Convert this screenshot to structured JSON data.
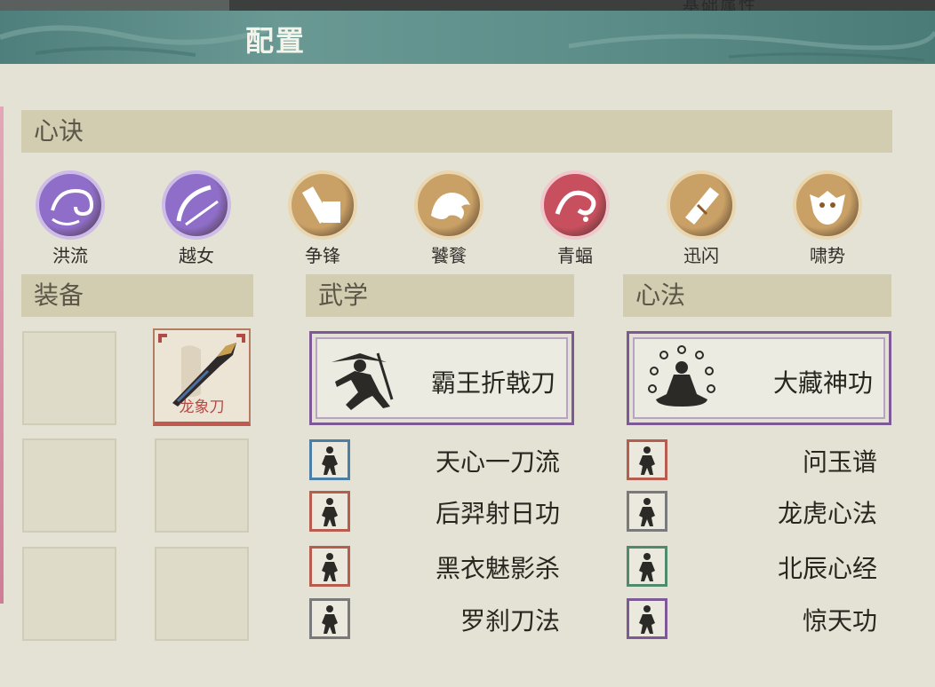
{
  "window": {
    "title": "配置",
    "background_text": "基础属性"
  },
  "sections": {
    "xinjue": "心诀",
    "zhuangbei": "装备",
    "wuxue": "武学",
    "xinfa": "心法"
  },
  "xinjue_skills": [
    {
      "label": "洪流",
      "icon": "wave-swirl-icon",
      "color": "#8f6ec9"
    },
    {
      "label": "越女",
      "icon": "sword-arc-icon",
      "color": "#8f6ec9"
    },
    {
      "label": "争锋",
      "icon": "hammer-icon",
      "color": "#c9a066"
    },
    {
      "label": "饕餮",
      "icon": "beast-icon",
      "color": "#c9a066"
    },
    {
      "label": "青蝠",
      "icon": "bat-swirl-icon",
      "color": "#c8505e"
    },
    {
      "label": "迅闪",
      "icon": "blade-icon",
      "color": "#c9a066"
    },
    {
      "label": "啸势",
      "icon": "tiger-mask-icon",
      "color": "#c9a066"
    }
  ],
  "equipment": {
    "weapon": {
      "name": "龙象刀",
      "icon": "broadsword-icon"
    }
  },
  "wuxue": {
    "main": {
      "name": "霸王折戟刀",
      "icon": "warrior-swordsman-icon"
    },
    "list": [
      {
        "name": "天心一刀流",
        "border": "#4d7fa6",
        "icon": "swordsman-icon"
      },
      {
        "name": "后羿射日功",
        "border": "#b75d4f",
        "icon": "archer-icon"
      },
      {
        "name": "黑衣魅影杀",
        "border": "#b75d4f",
        "icon": "assassin-icon"
      },
      {
        "name": "罗刹刀法",
        "border": "#7a7a7a",
        "icon": "blade-fighter-icon"
      }
    ]
  },
  "xinfa": {
    "main": {
      "name": "大藏神功",
      "icon": "meditating-monk-icon"
    },
    "list": [
      {
        "name": "问玉谱",
        "border": "#b75d4f",
        "icon": "meditation-icon"
      },
      {
        "name": "龙虎心法",
        "border": "#7a7a7a",
        "icon": "dragon-tiger-icon"
      },
      {
        "name": "北辰心经",
        "border": "#4f8a6c",
        "icon": "sage-icon"
      },
      {
        "name": "惊天功",
        "border": "#7d5a95",
        "icon": "dancer-icon"
      }
    ]
  }
}
